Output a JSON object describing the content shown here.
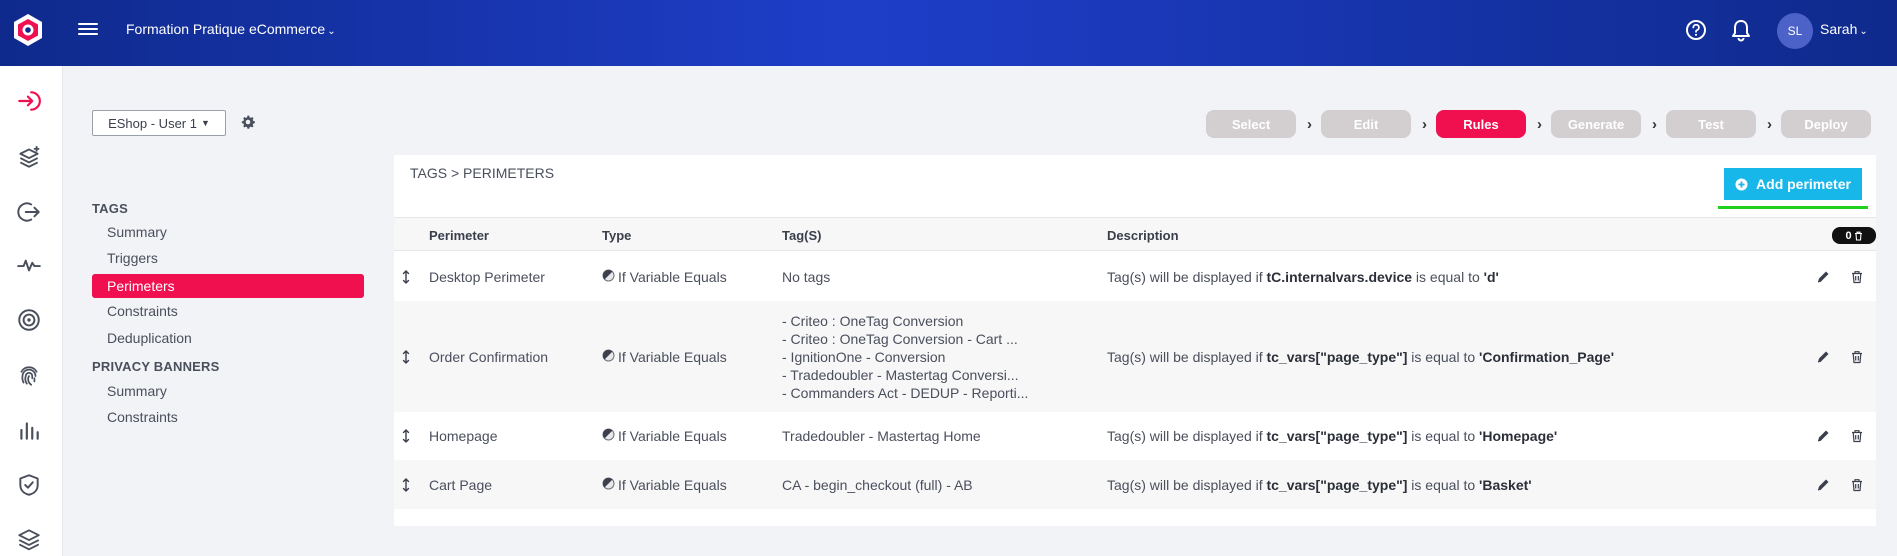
{
  "header": {
    "site_name": "Formation Pratique eCommerce",
    "user_initials": "SL",
    "user_name": "Sarah"
  },
  "environment": {
    "selected": "EShop - User 1"
  },
  "steps": [
    "Select",
    "Edit",
    "Rules",
    "Generate",
    "Test",
    "Deploy"
  ],
  "active_step": "Rules",
  "nav": {
    "tags_heading": "TAGS",
    "tags_items": [
      "Summary",
      "Triggers",
      "Perimeters",
      "Constraints",
      "Deduplication"
    ],
    "active_item": "Perimeters",
    "privacy_heading": "PRIVACY BANNERS",
    "privacy_items": [
      "Summary",
      "Constraints"
    ]
  },
  "panel": {
    "breadcrumb": "TAGS > PERIMETERS",
    "add_button": "Add perimeter",
    "columns": [
      "Perimeter",
      "Type",
      "Tag(S)",
      "Description"
    ],
    "count": "0",
    "rows": [
      {
        "perimeter": "Desktop Perimeter",
        "type": "If Variable Equals",
        "tags": [
          "No tags"
        ],
        "desc_prefix": "Tag(s) will be displayed if",
        "variable": "tC.internalvars.device",
        "desc_middle": "is equal to",
        "value": "'d'"
      },
      {
        "perimeter": "Order Confirmation",
        "type": "If Variable Equals",
        "tags": [
          "- Criteo : OneTag Conversion",
          "- Criteo : OneTag Conversion - Cart ...",
          "- IgnitionOne - Conversion",
          "- Tradedoubler - Mastertag Conversi...",
          "- Commanders Act - DEDUP - Reporti..."
        ],
        "desc_prefix": "Tag(s) will be displayed if",
        "variable": "tc_vars[\"page_type\"]",
        "desc_middle": "is equal to",
        "value": "'Confirmation_Page'"
      },
      {
        "perimeter": "Homepage",
        "type": "If Variable Equals",
        "tags": [
          "Tradedoubler - Mastertag Home"
        ],
        "desc_prefix": "Tag(s) will be displayed if",
        "variable": "tc_vars[\"page_type\"]",
        "desc_middle": "is equal to",
        "value": "'Homepage'"
      },
      {
        "perimeter": "Cart Page",
        "type": "If Variable Equals",
        "tags": [
          "CA - begin_checkout (full) - AB"
        ],
        "desc_prefix": "Tag(s) will be displayed if",
        "variable": "tc_vars[\"page_type\"]",
        "desc_middle": "is equal to",
        "value": "'Basket'"
      }
    ]
  },
  "colors": {
    "accent": "#f0104f",
    "primary": "#18b7ea",
    "header": "#1e3ec9",
    "highlight": "#22d11e"
  },
  "icons": [
    "app-logo-icon",
    "menu-icon",
    "help-icon",
    "bell-icon",
    "sign-in-icon",
    "layers-add-icon",
    "sign-out-icon",
    "activity-icon",
    "target-icon",
    "fingerprint-icon",
    "bar-chart-icon",
    "shield-icon",
    "stack-icon",
    "gear-icon",
    "plus-circle-icon",
    "trash-icon",
    "pencil-icon",
    "drag-handle-icon",
    "variable-type-icon"
  ]
}
